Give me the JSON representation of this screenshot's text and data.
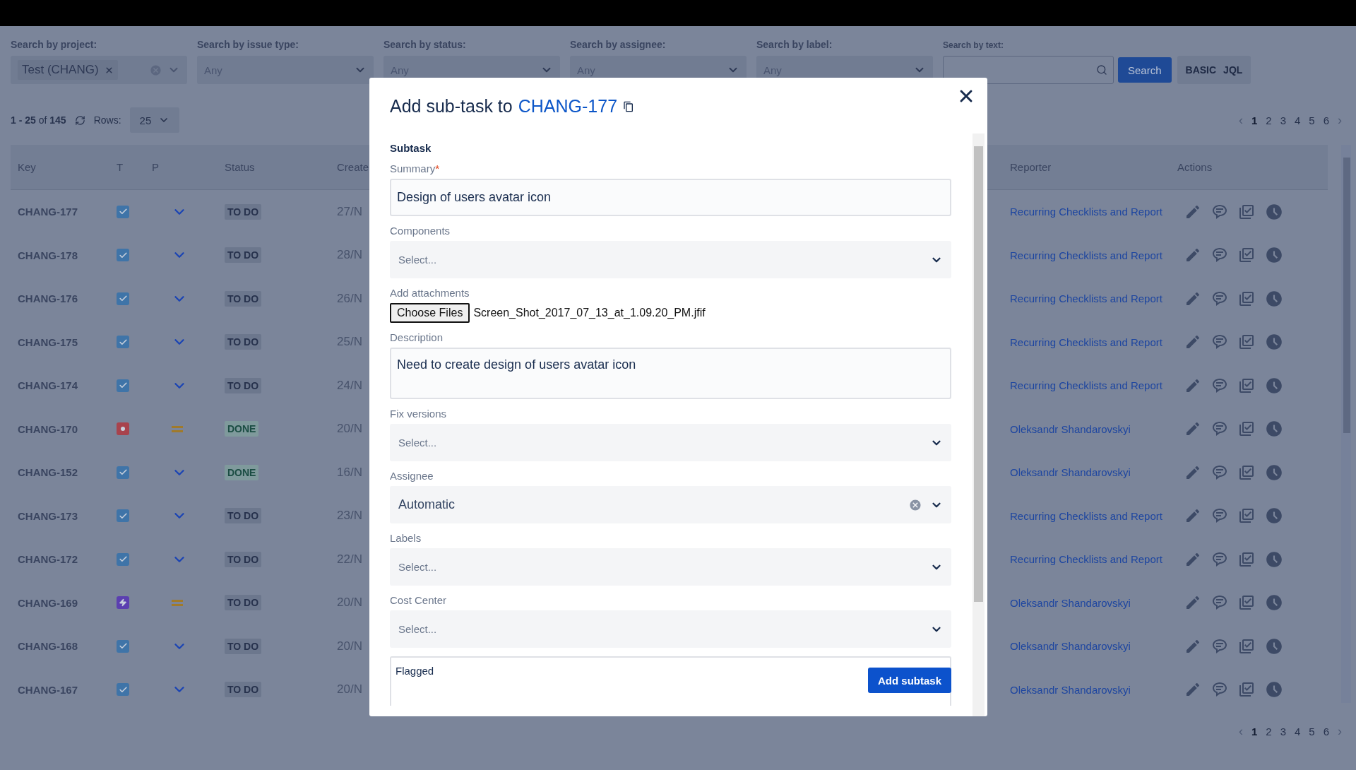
{
  "filters": [
    {
      "label": "Search by project:",
      "kind": "chip",
      "chip": "Test (CHANG)"
    },
    {
      "label": "Search by issue type:",
      "kind": "select",
      "value": "Any"
    },
    {
      "label": "Search by status:",
      "kind": "select",
      "value": "Any"
    },
    {
      "label": "Search by assignee:",
      "kind": "select",
      "value": "Any"
    },
    {
      "label": "Search by label:",
      "kind": "select",
      "value": "Any"
    },
    {
      "label": "Search by text:",
      "kind": "text"
    }
  ],
  "search_button": "Search",
  "mode_buttons": [
    "BASIC",
    "JQL"
  ],
  "summary": {
    "count": "**1 - 25** of **145**",
    "rows_label": "Rows:",
    "rows_value": "25"
  },
  "pagination_top": {
    "prev": "‹",
    "next": "›",
    "pages": [
      {
        "label": "1",
        "selected": true
      },
      {
        "label": "2",
        "selected": false
      },
      {
        "label": "3",
        "selected": false
      },
      {
        "label": "4",
        "selected": false
      },
      {
        "label": "5",
        "selected": false
      },
      {
        "label": "6",
        "selected": false
      }
    ]
  },
  "table": {
    "columns": [
      "Key",
      "T",
      "P",
      "Status",
      "Create",
      "Reporter",
      "Actions"
    ],
    "rows": [
      {
        "key": "CHANG-177",
        "type": {
          "kind": "task"
        },
        "priority": {
          "kind": "low"
        },
        "status": {
          "label": "TO DO",
          "kind": "todo"
        },
        "created": "27/N",
        "reporter": "Recurring Checklists and Report"
      },
      {
        "key": "CHANG-178",
        "type": {
          "kind": "task"
        },
        "priority": {
          "kind": "low"
        },
        "status": {
          "label": "TO DO",
          "kind": "todo"
        },
        "created": "28/N",
        "reporter": "Recurring Checklists and Report"
      },
      {
        "key": "CHANG-176",
        "type": {
          "kind": "task"
        },
        "priority": {
          "kind": "low"
        },
        "status": {
          "label": "TO DO",
          "kind": "todo"
        },
        "created": "26/N",
        "reporter": "Recurring Checklists and Report"
      },
      {
        "key": "CHANG-175",
        "type": {
          "kind": "task"
        },
        "priority": {
          "kind": "low"
        },
        "status": {
          "label": "TO DO",
          "kind": "todo"
        },
        "created": "25/N",
        "reporter": "Recurring Checklists and Report"
      },
      {
        "key": "CHANG-174",
        "type": {
          "kind": "task"
        },
        "priority": {
          "kind": "low"
        },
        "status": {
          "label": "TO DO",
          "kind": "todo"
        },
        "created": "24/N",
        "reporter": "Recurring Checklists and Report"
      },
      {
        "key": "CHANG-170",
        "type": {
          "kind": "bug"
        },
        "priority": {
          "kind": "medium"
        },
        "status": {
          "label": "DONE",
          "kind": "done"
        },
        "created": "20/N",
        "reporter": "Oleksandr Shandarovskyi"
      },
      {
        "key": "CHANG-152",
        "type": {
          "kind": "task"
        },
        "priority": {
          "kind": "low"
        },
        "status": {
          "label": "DONE",
          "kind": "done"
        },
        "created": "16/N",
        "reporter": "Oleksandr Shandarovskyi"
      },
      {
        "key": "CHANG-173",
        "type": {
          "kind": "task"
        },
        "priority": {
          "kind": "low"
        },
        "status": {
          "label": "TO DO",
          "kind": "todo"
        },
        "created": "23/N",
        "reporter": "Recurring Checklists and Report"
      },
      {
        "key": "CHANG-172",
        "type": {
          "kind": "task"
        },
        "priority": {
          "kind": "low"
        },
        "status": {
          "label": "TO DO",
          "kind": "todo"
        },
        "created": "22/N",
        "reporter": "Recurring Checklists and Report"
      },
      {
        "key": "CHANG-169",
        "type": {
          "kind": "epic"
        },
        "priority": {
          "kind": "medium"
        },
        "status": {
          "label": "TO DO",
          "kind": "todo"
        },
        "created": "20/N",
        "reporter": "Oleksandr Shandarovskyi"
      },
      {
        "key": "CHANG-168",
        "type": {
          "kind": "task"
        },
        "priority": {
          "kind": "low"
        },
        "status": {
          "label": "TO DO",
          "kind": "todo"
        },
        "created": "20/N",
        "reporter": "Oleksandr Shandarovskyi"
      },
      {
        "key": "CHANG-167",
        "type": {
          "kind": "task"
        },
        "priority": {
          "kind": "low"
        },
        "status": {
          "label": "TO DO",
          "kind": "todo"
        },
        "created": "20/N",
        "reporter": "Oleksandr Shandarovskyi"
      }
    ]
  },
  "pagination_bottom": {
    "prev": "‹",
    "next": "›",
    "pages": [
      {
        "label": "1",
        "selected": true
      },
      {
        "label": "2",
        "selected": false
      },
      {
        "label": "3",
        "selected": false
      },
      {
        "label": "4",
        "selected": false
      },
      {
        "label": "5",
        "selected": false
      },
      {
        "label": "6",
        "selected": false
      }
    ]
  },
  "modal": {
    "title": "Add sub-task to",
    "issue_link": "CHANG-177",
    "section": "Subtask",
    "fields": [
      {
        "kind": "text",
        "label": "Summary",
        "required_mark": "*",
        "value": "Design of users avatar icon"
      },
      {
        "kind": "select",
        "label": "Components",
        "placeholder": "Select..."
      },
      {
        "kind": "file",
        "label": "Add attachments",
        "button": "Choose Files",
        "value": "Screen_Shot_2017_07_13_at_1.09.20_PM.jfif"
      },
      {
        "kind": "textarea",
        "label": "Description",
        "value": "Need to create design of users avatar icon"
      },
      {
        "kind": "select",
        "label": "Fix versions",
        "placeholder": "Select..."
      },
      {
        "kind": "select",
        "label": "Assignee",
        "value": "Automatic"
      },
      {
        "kind": "select",
        "label": "Labels",
        "placeholder": "Select..."
      },
      {
        "kind": "select",
        "label": "Cost Center",
        "placeholder": "Select..."
      },
      {
        "kind": "box",
        "label": "Flagged"
      }
    ],
    "submit": "Add subtask"
  }
}
